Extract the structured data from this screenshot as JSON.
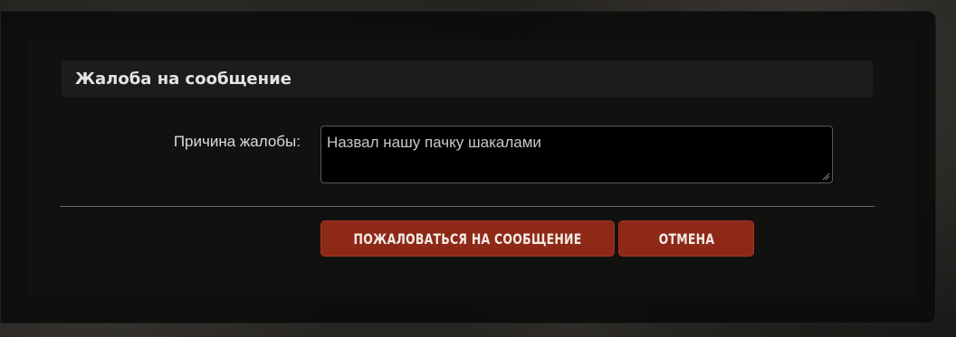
{
  "dialog": {
    "title": "Жалоба на сообщение",
    "reason_label": "Причина жалобы:",
    "reason_value": "Назвал нашу пачку шакалами",
    "submit_label": "ПОЖАЛОВАТЬСЯ НА СООБЩЕНИЕ",
    "cancel_label": "ОТМЕНА"
  },
  "colors": {
    "button_bg": "#8e2817",
    "overlay_bg": "#0c0c0c",
    "title_bar_bg": "#1c1c1c"
  },
  "icons": {
    "textarea_resize": "resize-grip-icon"
  }
}
